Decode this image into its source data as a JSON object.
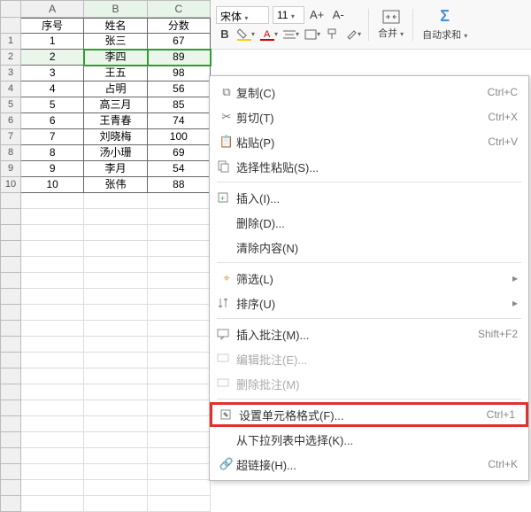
{
  "toolbar": {
    "font_name": "宋体",
    "font_size": "11",
    "increase_font": "A+",
    "decrease_font": "A-",
    "bold": "B",
    "merge_label": "合并",
    "autosum_label": "自动求和"
  },
  "columns": [
    "A",
    "B",
    "C"
  ],
  "header_row": {
    "a": "序号",
    "b": "姓名",
    "c": "分数"
  },
  "rows": [
    {
      "n": "1",
      "a": "1",
      "b": "张三",
      "c": "67"
    },
    {
      "n": "2",
      "a": "2",
      "b": "李四",
      "c": "89"
    },
    {
      "n": "3",
      "a": "3",
      "b": "王五",
      "c": "98"
    },
    {
      "n": "4",
      "a": "4",
      "b": "占明",
      "c": "56"
    },
    {
      "n": "5",
      "a": "5",
      "b": "高三月",
      "c": "85"
    },
    {
      "n": "6",
      "a": "6",
      "b": "王青春",
      "c": "74"
    },
    {
      "n": "7",
      "a": "7",
      "b": "刘晓梅",
      "c": "100"
    },
    {
      "n": "8",
      "a": "8",
      "b": "汤小珊",
      "c": "69"
    },
    {
      "n": "9",
      "a": "9",
      "b": "李月",
      "c": "54"
    },
    {
      "n": "10",
      "a": "10",
      "b": "张伟",
      "c": "88"
    }
  ],
  "selected_row_index": 1,
  "context_menu": {
    "copy": {
      "label": "复制(C)",
      "shortcut": "Ctrl+C"
    },
    "cut": {
      "label": "剪切(T)",
      "shortcut": "Ctrl+X"
    },
    "paste": {
      "label": "粘贴(P)",
      "shortcut": "Ctrl+V"
    },
    "paste_special": {
      "label": "选择性粘贴(S)..."
    },
    "insert": {
      "label": "插入(I)..."
    },
    "delete": {
      "label": "删除(D)..."
    },
    "clear": {
      "label": "清除内容(N)"
    },
    "filter": {
      "label": "筛选(L)"
    },
    "sort": {
      "label": "排序(U)"
    },
    "insert_comment": {
      "label": "插入批注(M)...",
      "shortcut": "Shift+F2"
    },
    "edit_comment": {
      "label": "编辑批注(E)..."
    },
    "delete_comment": {
      "label": "删除批注(M)"
    },
    "format_cells": {
      "label": "设置单元格格式(F)...",
      "shortcut": "Ctrl+1"
    },
    "pick_from_list": {
      "label": "从下拉列表中选择(K)..."
    },
    "hyperlink": {
      "label": "超链接(H)...",
      "shortcut": "Ctrl+K"
    }
  }
}
